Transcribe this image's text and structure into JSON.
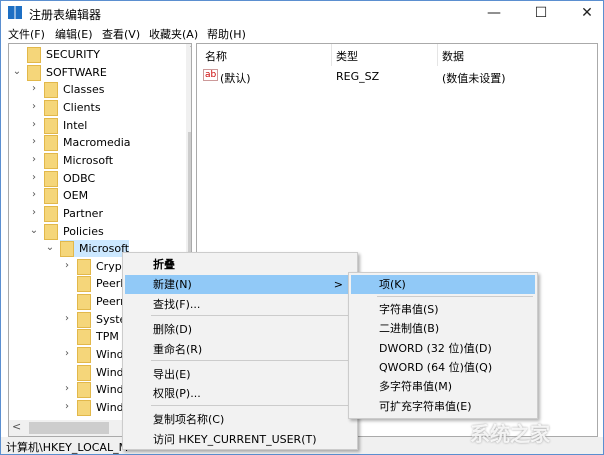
{
  "window": {
    "title": "注册表编辑器",
    "minimize": "—",
    "maximize": "☐",
    "close": "✕"
  },
  "menubar": [
    "文件(F)",
    "编辑(E)",
    "查看(V)",
    "收藏夹(A)",
    "帮助(H)"
  ],
  "tree": [
    {
      "label": "SECURITY",
      "level": 0,
      "chev": ""
    },
    {
      "label": "SOFTWARE",
      "level": 0,
      "chev": "v"
    },
    {
      "label": "Classes",
      "level": 1,
      "chev": ">"
    },
    {
      "label": "Clients",
      "level": 1,
      "chev": ">"
    },
    {
      "label": "Intel",
      "level": 1,
      "chev": ">"
    },
    {
      "label": "Macromedia",
      "level": 1,
      "chev": ">"
    },
    {
      "label": "Microsoft",
      "level": 1,
      "chev": ">"
    },
    {
      "label": "ODBC",
      "level": 1,
      "chev": ">"
    },
    {
      "label": "OEM",
      "level": 1,
      "chev": ">"
    },
    {
      "label": "Partner",
      "level": 1,
      "chev": ">"
    },
    {
      "label": "Policies",
      "level": 1,
      "chev": "v"
    },
    {
      "label": "Microsoft",
      "level": 2,
      "chev": "v",
      "selected": true
    },
    {
      "label": "Crypt",
      "level": 3,
      "chev": ">"
    },
    {
      "label": "PeerD",
      "level": 3,
      "chev": ""
    },
    {
      "label": "Peerr",
      "level": 3,
      "chev": ""
    },
    {
      "label": "Syste",
      "level": 3,
      "chev": ">"
    },
    {
      "label": "TPM",
      "level": 3,
      "chev": ""
    },
    {
      "label": "Wind",
      "level": 3,
      "chev": ">"
    },
    {
      "label": "Wind",
      "level": 3,
      "chev": ""
    },
    {
      "label": "Wind",
      "level": 3,
      "chev": ">"
    },
    {
      "label": "Wind",
      "level": 3,
      "chev": ">"
    }
  ],
  "list": {
    "headers": [
      "名称",
      "类型",
      "数据"
    ],
    "rows": [
      {
        "name": "(默认)",
        "type": "REG_SZ",
        "data": "(数值未设置)",
        "icon": "ab"
      }
    ]
  },
  "status": "计算机\\HKEY_LOCAL_MACHINE\\SOFTWARE\\Policies\\Microsoft",
  "status_visible": "计算机\\HKEY_LOCAL_M",
  "context_menu": {
    "items": [
      "折叠",
      "新建(N)",
      "查找(F)...",
      "删除(D)",
      "重命名(R)",
      "导出(E)",
      "权限(P)...",
      "复制项名称(C)",
      "访问 HKEY_CURRENT_USER(T)"
    ],
    "submenu_arrow": ">"
  },
  "submenu": {
    "items": [
      "项(K)",
      "字符串值(S)",
      "二进制值(B)",
      "DWORD (32 位)值(D)",
      "QWORD (64 位)值(Q)",
      "多字符串值(M)",
      "可扩充字符串值(E)"
    ]
  },
  "watermark": "系统之家"
}
